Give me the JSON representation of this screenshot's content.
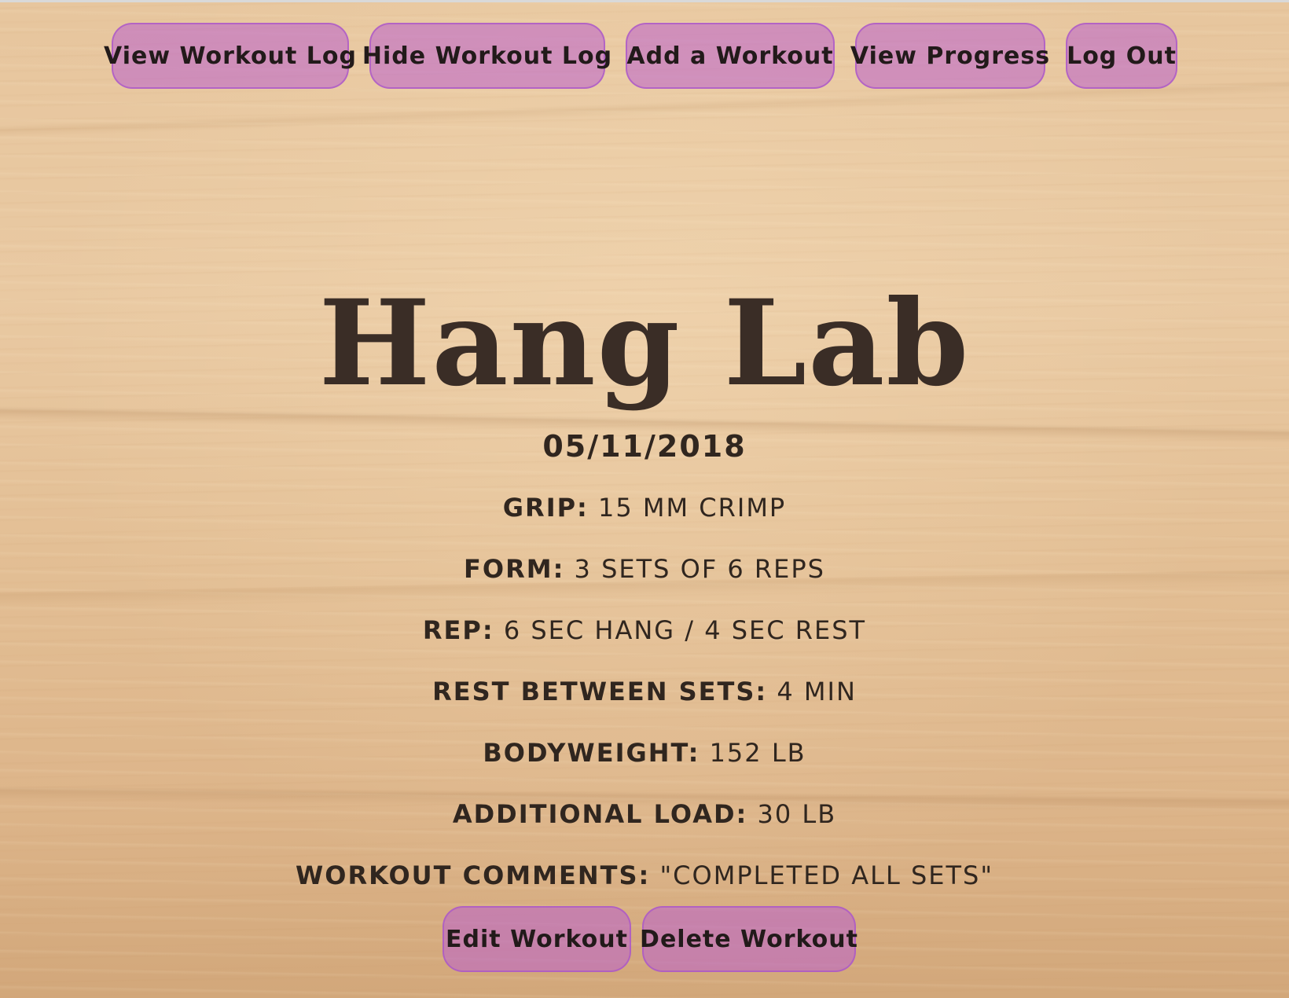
{
  "nav": {
    "view_log": "View Workout Log",
    "hide_log": "Hide Workout Log",
    "add_workout": "Add a Workout",
    "view_progress": "View Progress",
    "log_out": "Log Out"
  },
  "app_title": "Hang Lab",
  "workout": {
    "date": "05/11/2018",
    "fields": [
      {
        "label": "Grip:",
        "value": "15 mm crimp"
      },
      {
        "label": "Form:",
        "value": "3 sets of 6 reps"
      },
      {
        "label": "Rep:",
        "value": "6 sec hang / 4 sec rest"
      },
      {
        "label": "Rest between sets:",
        "value": "4 min"
      },
      {
        "label": "Bodyweight:",
        "value": "152 lb"
      },
      {
        "label": "Additional load:",
        "value": "30 lb"
      },
      {
        "label": "Workout comments:",
        "value": "\"completed all sets\""
      }
    ]
  },
  "actions": {
    "edit": "Edit Workout",
    "delete": "Delete Workout"
  },
  "colors": {
    "button_fill": "#b95fcd",
    "text": "#2f2622",
    "wood": "#e7c69e"
  }
}
